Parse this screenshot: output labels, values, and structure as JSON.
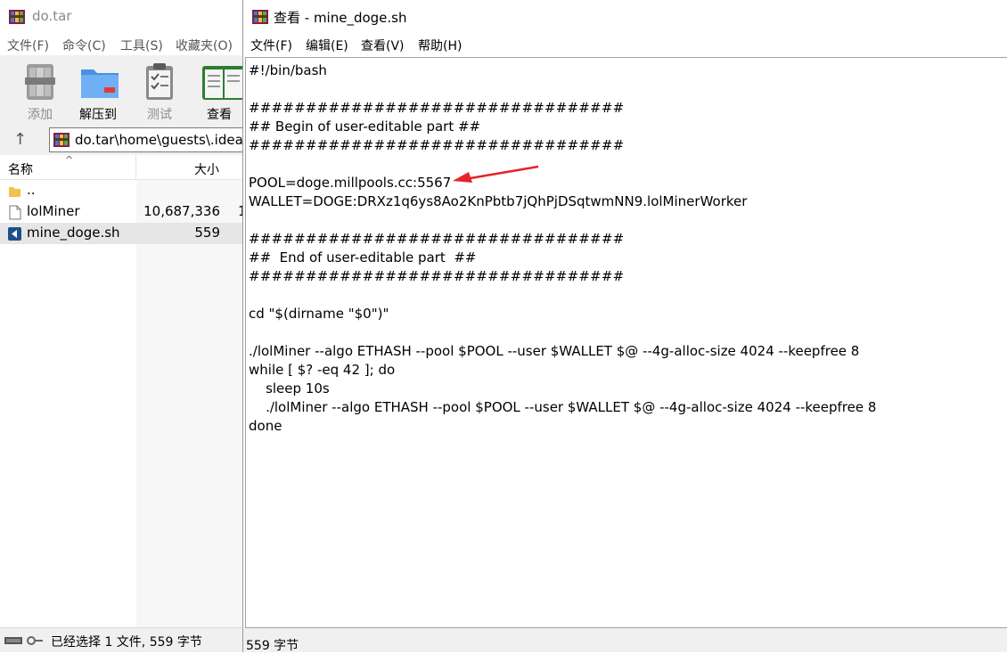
{
  "winrar": {
    "title": "do.tar",
    "menu": [
      "文件(F)",
      "命令(C)",
      "工具(S)",
      "收藏夹(O)"
    ],
    "toolbar": [
      {
        "label": "添加",
        "icon": "add-archive-icon"
      },
      {
        "label": "解压到",
        "icon": "extract-folder-icon"
      },
      {
        "label": "测试",
        "icon": "test-clipboard-icon"
      },
      {
        "label": "查看",
        "icon": "view-book-icon"
      }
    ],
    "address": "do.tar\\home\\guests\\.idea",
    "columns": {
      "name": "名称",
      "size": "大小"
    },
    "files": [
      {
        "name": "..",
        "size": "",
        "icon": "folder-icon"
      },
      {
        "name": "lolMiner",
        "size": "10,687,336",
        "extra": "1",
        "icon": "file-icon"
      },
      {
        "name": "mine_doge.sh",
        "size": "559",
        "icon": "script-icon"
      }
    ],
    "status": "已经选择 1 文件, 559 字节"
  },
  "viewer": {
    "title": "查看 - mine_doge.sh",
    "menu": [
      "文件(F)",
      "编辑(E)",
      "查看(V)",
      "帮助(H)"
    ],
    "lines": [
      "#!/bin/bash",
      "",
      "#################################",
      "## Begin of user-editable part ##",
      "#################################",
      "",
      "POOL=doge.millpools.cc:5567",
      "WALLET=DOGE:DRXz1q6ys8Ao2KnPbtb7jQhPjDSqtwmNN9.lolMinerWorker",
      "",
      "#################################",
      "##  End of user-editable part  ##",
      "#################################",
      "",
      "cd \"$(dirname \"$0\")\"",
      "",
      "./lolMiner --algo ETHASH --pool $POOL --user $WALLET $@ --4g-alloc-size 4024 --keepfree 8",
      "while [ $? -eq 42 ]; do",
      "    sleep 10s",
      "    ./lolMiner --algo ETHASH --pool $POOL --user $WALLET $@ --4g-alloc-size 4024 --keepfree 8",
      "done"
    ],
    "status": "559 字节",
    "annotation_color": "#e8212b"
  }
}
